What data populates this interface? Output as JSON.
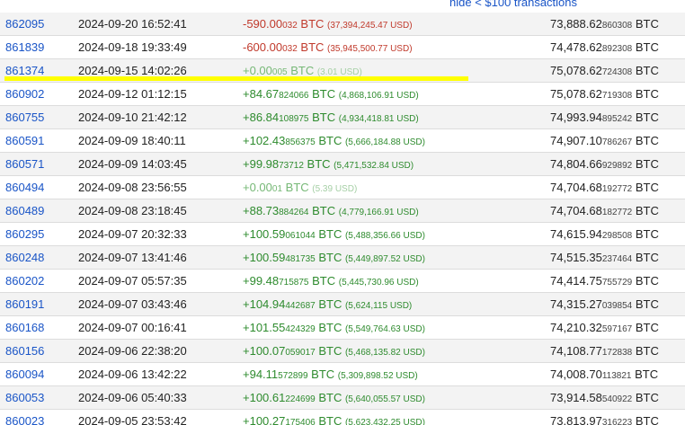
{
  "header": {
    "hide_link": "hide < $100 transactions"
  },
  "rows": [
    {
      "block": "862095",
      "date": "2024-09-20 16:52:41",
      "sign": "neg",
      "amt_main": "-590.00",
      "amt_small": "032",
      "amt_unit": " BTC ",
      "usd": "(37,394,245.47 USD)",
      "bal_main": "73,888.62",
      "bal_small": "860308",
      "bal_unit": " BTC"
    },
    {
      "block": "861839",
      "date": "2024-09-18 19:33:49",
      "sign": "neg",
      "amt_main": "-600.00",
      "amt_small": "032",
      "amt_unit": " BTC ",
      "usd": "(35,945,500.77 USD)",
      "bal_main": "74,478.62",
      "bal_small": "892308",
      "bal_unit": " BTC"
    },
    {
      "block": "861374",
      "date": "2024-09-15 14:02:26",
      "sign": "zero",
      "amt_main": "+0.00",
      "amt_small": "005",
      "amt_unit": " BTC ",
      "usd": "(3.01 USD)",
      "bal_main": "75,078.62",
      "bal_small": "724308",
      "bal_unit": " BTC"
    },
    {
      "block": "860902",
      "date": "2024-09-12 01:12:15",
      "sign": "pos",
      "amt_main": "+84.67",
      "amt_small": "824066",
      "amt_unit": " BTC ",
      "usd": "(4,868,106.91 USD)",
      "bal_main": "75,078.62",
      "bal_small": "719308",
      "bal_unit": " BTC"
    },
    {
      "block": "860755",
      "date": "2024-09-10 21:42:12",
      "sign": "pos",
      "amt_main": "+86.84",
      "amt_small": "108975",
      "amt_unit": " BTC ",
      "usd": "(4,934,418.81 USD)",
      "bal_main": "74,993.94",
      "bal_small": "895242",
      "bal_unit": " BTC"
    },
    {
      "block": "860591",
      "date": "2024-09-09 18:40:11",
      "sign": "pos",
      "amt_main": "+102.43",
      "amt_small": "856375",
      "amt_unit": " BTC ",
      "usd": "(5,666,184.88 USD)",
      "bal_main": "74,907.10",
      "bal_small": "786267",
      "bal_unit": " BTC"
    },
    {
      "block": "860571",
      "date": "2024-09-09 14:03:45",
      "sign": "pos",
      "amt_main": "+99.98",
      "amt_small": "73712",
      "amt_unit": " BTC ",
      "usd": "(5,471,532.84 USD)",
      "bal_main": "74,804.66",
      "bal_small": "929892",
      "bal_unit": " BTC"
    },
    {
      "block": "860494",
      "date": "2024-09-08 23:56:55",
      "sign": "zero",
      "amt_main": "+0.00",
      "amt_small": "01",
      "amt_unit": " BTC ",
      "usd": "(5.39 USD)",
      "bal_main": "74,704.68",
      "bal_small": "192772",
      "bal_unit": " BTC"
    },
    {
      "block": "860489",
      "date": "2024-09-08 23:18:45",
      "sign": "pos",
      "amt_main": "+88.73",
      "amt_small": "884264",
      "amt_unit": " BTC ",
      "usd": "(4,779,166.91 USD)",
      "bal_main": "74,704.68",
      "bal_small": "182772",
      "bal_unit": " BTC"
    },
    {
      "block": "860295",
      "date": "2024-09-07 20:32:33",
      "sign": "pos",
      "amt_main": "+100.59",
      "amt_small": "061044",
      "amt_unit": " BTC ",
      "usd": "(5,488,356.66 USD)",
      "bal_main": "74,615.94",
      "bal_small": "298508",
      "bal_unit": " BTC"
    },
    {
      "block": "860248",
      "date": "2024-09-07 13:41:46",
      "sign": "pos",
      "amt_main": "+100.59",
      "amt_small": "481735",
      "amt_unit": " BTC ",
      "usd": "(5,449,897.52 USD)",
      "bal_main": "74,515.35",
      "bal_small": "237464",
      "bal_unit": " BTC"
    },
    {
      "block": "860202",
      "date": "2024-09-07 05:57:35",
      "sign": "pos",
      "amt_main": "+99.48",
      "amt_small": "715875",
      "amt_unit": " BTC ",
      "usd": "(5,445,730.96 USD)",
      "bal_main": "74,414.75",
      "bal_small": "755729",
      "bal_unit": " BTC"
    },
    {
      "block": "860191",
      "date": "2024-09-07 03:43:46",
      "sign": "pos",
      "amt_main": "+104.94",
      "amt_small": "442687",
      "amt_unit": " BTC ",
      "usd": "(5,624,115 USD)",
      "bal_main": "74,315.27",
      "bal_small": "039854",
      "bal_unit": " BTC"
    },
    {
      "block": "860168",
      "date": "2024-09-07 00:16:41",
      "sign": "pos",
      "amt_main": "+101.55",
      "amt_small": "424329",
      "amt_unit": " BTC ",
      "usd": "(5,549,764.63 USD)",
      "bal_main": "74,210.32",
      "bal_small": "597167",
      "bal_unit": " BTC"
    },
    {
      "block": "860156",
      "date": "2024-09-06 22:38:20",
      "sign": "pos",
      "amt_main": "+100.07",
      "amt_small": "059017",
      "amt_unit": " BTC ",
      "usd": "(5,468,135.82 USD)",
      "bal_main": "74,108.77",
      "bal_small": "172838",
      "bal_unit": " BTC"
    },
    {
      "block": "860094",
      "date": "2024-09-06 13:42:22",
      "sign": "pos",
      "amt_main": "+94.11",
      "amt_small": "572899",
      "amt_unit": " BTC ",
      "usd": "(5,309,898.52 USD)",
      "bal_main": "74,008.70",
      "bal_small": "113821",
      "bal_unit": " BTC"
    },
    {
      "block": "860053",
      "date": "2024-09-06 05:40:33",
      "sign": "pos",
      "amt_main": "+100.61",
      "amt_small": "224699",
      "amt_unit": " BTC ",
      "usd": "(5,640,055.57 USD)",
      "bal_main": "73,914.58",
      "bal_small": "540922",
      "bal_unit": " BTC"
    },
    {
      "block": "860023",
      "date": "2024-09-05 23:53:42",
      "sign": "pos",
      "amt_main": "+100.27",
      "amt_small": "175406",
      "amt_unit": " BTC ",
      "usd": "(5,623,432.25 USD)",
      "bal_main": "73,813.97",
      "bal_small": "316223",
      "bal_unit": " BTC"
    }
  ],
  "colors": {
    "link": "#1a55c7",
    "negative": "#c0392b",
    "positive": "#2e8b2e",
    "highlight": "#ffff00"
  }
}
